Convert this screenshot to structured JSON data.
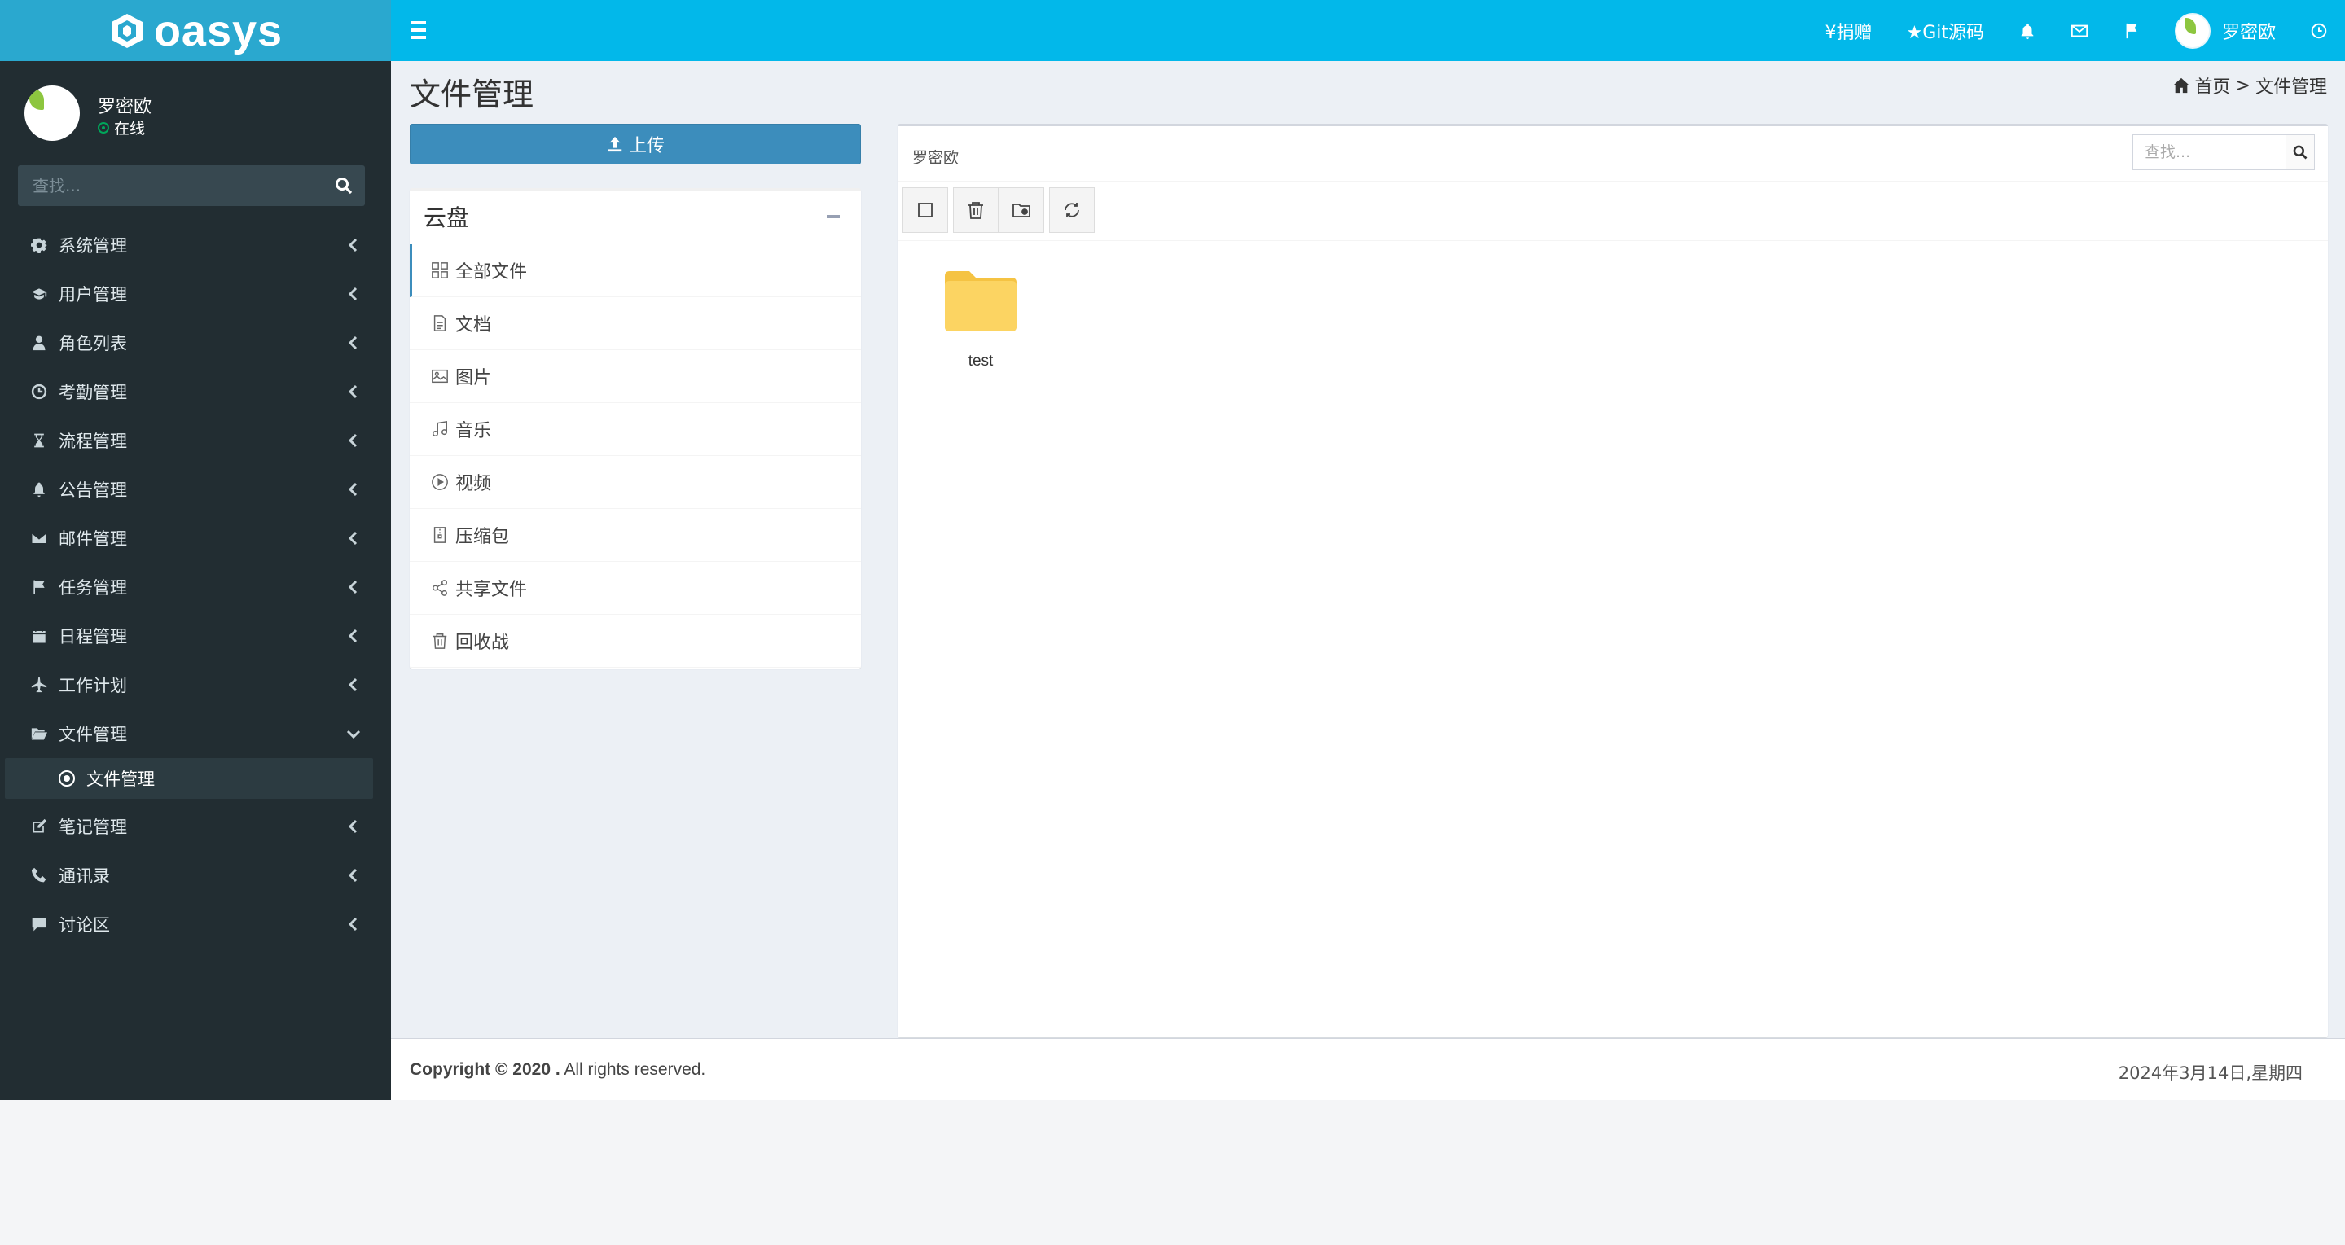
{
  "app": {
    "logo_text": "oasys"
  },
  "topbar": {
    "items": [
      {
        "label": "¥捐赠"
      },
      {
        "label": "★Git源码"
      }
    ],
    "user_name": "罗密欧"
  },
  "sidebar": {
    "user": {
      "name": "罗密欧",
      "status": "在线"
    },
    "search_placeholder": "查找...",
    "items": [
      {
        "label": "系统管理",
        "icon": "gear-icon"
      },
      {
        "label": "用户管理",
        "icon": "graduation-cap-icon"
      },
      {
        "label": "角色列表",
        "icon": "user-icon"
      },
      {
        "label": "考勤管理",
        "icon": "clock-icon"
      },
      {
        "label": "流程管理",
        "icon": "hourglass-icon"
      },
      {
        "label": "公告管理",
        "icon": "bell-icon"
      },
      {
        "label": "邮件管理",
        "icon": "envelope-icon"
      },
      {
        "label": "任务管理",
        "icon": "flag-icon"
      },
      {
        "label": "日程管理",
        "icon": "calendar-icon"
      },
      {
        "label": "工作计划",
        "icon": "plane-icon"
      },
      {
        "label": "文件管理",
        "icon": "folder-open-icon",
        "expanded": true,
        "sub": [
          {
            "label": "文件管理"
          }
        ]
      },
      {
        "label": "笔记管理",
        "icon": "edit-icon"
      },
      {
        "label": "通讯录",
        "icon": "phone-icon"
      },
      {
        "label": "讨论区",
        "icon": "comment-icon"
      }
    ]
  },
  "page": {
    "title": "文件管理",
    "breadcrumb": {
      "home": "首页",
      "separator": ">",
      "current": "文件管理"
    }
  },
  "upload_label": "上传",
  "cloud": {
    "title": "云盘",
    "items": [
      {
        "label": "全部文件",
        "icon": "grid-icon",
        "active": true
      },
      {
        "label": "文档",
        "icon": "document-icon"
      },
      {
        "label": "图片",
        "icon": "image-icon"
      },
      {
        "label": "音乐",
        "icon": "music-icon"
      },
      {
        "label": "视频",
        "icon": "play-circle-icon"
      },
      {
        "label": "压缩包",
        "icon": "archive-icon"
      },
      {
        "label": "共享文件",
        "icon": "share-icon"
      },
      {
        "label": "回收战",
        "icon": "trash-icon"
      }
    ]
  },
  "file_panel": {
    "path": "罗密欧",
    "search_placeholder": "查找...",
    "files": [
      {
        "name": "test",
        "type": "folder"
      }
    ]
  },
  "footer": {
    "copyright_bold": "Copyright © 2020 .",
    "copyright_rest": " All rights reserved.",
    "date": "2024年3月14日,星期四"
  },
  "colors": {
    "topbar": "#02b8ea",
    "logo_bg": "#2aa8cf",
    "sidebar": "#222d32",
    "primary_button": "#3c8dbc",
    "folder": "#fcd462"
  }
}
